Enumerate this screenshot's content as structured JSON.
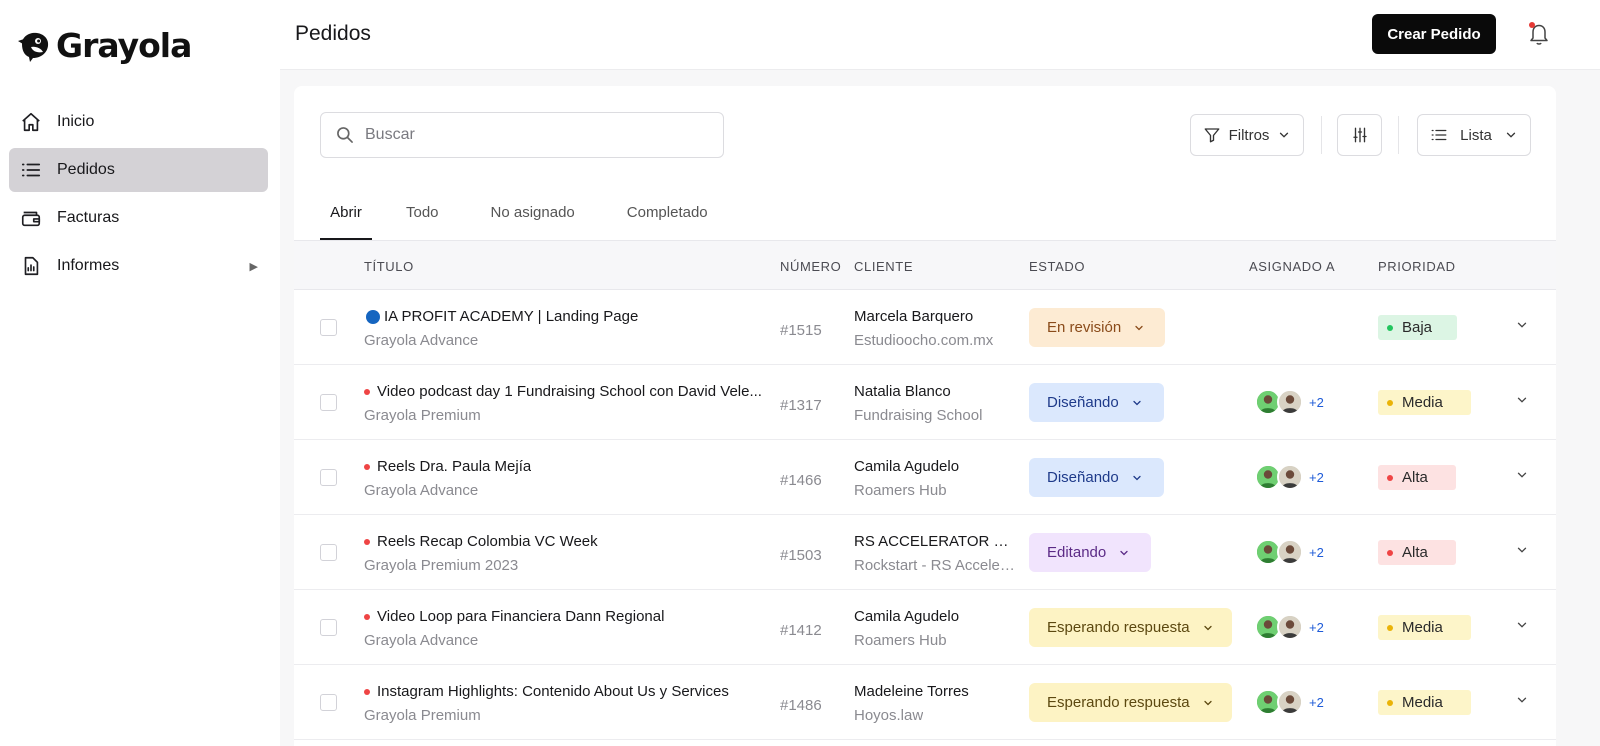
{
  "app": {
    "name": "Grayola"
  },
  "sidebar": {
    "items": [
      {
        "label": "Inicio",
        "icon": "home-icon",
        "active": false
      },
      {
        "label": "Pedidos",
        "icon": "list-icon",
        "active": true
      },
      {
        "label": "Facturas",
        "icon": "wallet-icon",
        "active": false
      },
      {
        "label": "Informes",
        "icon": "chart-icon",
        "active": false,
        "has_submenu": true
      }
    ]
  },
  "header": {
    "title": "Pedidos",
    "create_label": "Crear Pedido"
  },
  "toolbar": {
    "search_placeholder": "Buscar",
    "filters_label": "Filtros",
    "view_label": "Lista"
  },
  "tabs": [
    "Abrir",
    "Todo",
    "No asignado",
    "Completado"
  ],
  "columns": {
    "title": "TÍTULO",
    "number": "NÚMERO",
    "client": "CLIENTE",
    "status": "ESTADO",
    "assignee": "ASIGNADO A",
    "priority": "PRIORIDAD"
  },
  "colors": {
    "status": {
      "En revisión": {
        "bg": "#fdebd3",
        "fg": "#8a4b1a"
      },
      "Diseñando": {
        "bg": "#dbe8fd",
        "fg": "#1e3a8a"
      },
      "Editando": {
        "bg": "#f1e4fd",
        "fg": "#5b2a86"
      },
      "Esperando respuesta": {
        "bg": "#fdf3c4",
        "fg": "#5c4810"
      }
    },
    "priority": {
      "Baja": {
        "bg": "#dcf5e4",
        "dot": "#22c55e"
      },
      "Media": {
        "bg": "#fdf5c9",
        "dot": "#eab308"
      },
      "Alta": {
        "bg": "#fde2e2",
        "dot": "#ef4444"
      }
    }
  },
  "orders": [
    {
      "title": "IA PROFIT ACADEMY | Landing Page",
      "marker": "blue-circle",
      "plan": "Grayola Advance",
      "number": "#1515",
      "client": "Marcela Barquero",
      "company": "Estudioocho.com.mx",
      "status": "En revisión",
      "assignees": [],
      "more": "",
      "priority": "Baja"
    },
    {
      "title": "Video podcast day 1 Fundraising School con David Vele...",
      "marker": "red-dot",
      "plan": "Grayola Premium",
      "number": "#1317",
      "client": "Natalia Blanco",
      "company": "Fundraising School",
      "status": "Diseñando",
      "assignees": [
        "avatar-1",
        "avatar-2"
      ],
      "more": "+2",
      "priority": "Media"
    },
    {
      "title": "Reels Dra. Paula Mejía",
      "marker": "red-dot",
      "plan": "Grayola Advance",
      "number": "#1466",
      "client": "Camila Agudelo",
      "company": "Roamers Hub",
      "status": "Diseñando",
      "assignees": [
        "avatar-1",
        "avatar-2"
      ],
      "more": "+2",
      "priority": "Alta"
    },
    {
      "title": "Reels Recap Colombia VC Week",
      "marker": "red-dot",
      "plan": "Grayola Premium 2023",
      "number": "#1503",
      "client": "RS ACCELERATOR MA...",
      "company": "Rockstart - RS Acceler...",
      "status": "Editando",
      "assignees": [
        "avatar-1",
        "avatar-2"
      ],
      "more": "+2",
      "priority": "Alta"
    },
    {
      "title": "Video Loop para Financiera Dann Regional",
      "marker": "red-dot",
      "plan": "Grayola Advance",
      "number": "#1412",
      "client": "Camila Agudelo",
      "company": "Roamers Hub",
      "status": "Esperando respuesta",
      "assignees": [
        "avatar-1",
        "avatar-2"
      ],
      "more": "+2",
      "priority": "Media"
    },
    {
      "title": "Instagram Highlights: Contenido About Us y Services",
      "marker": "red-dot",
      "plan": "Grayola Premium",
      "number": "#1486",
      "client": "Madeleine Torres",
      "company": "Hoyos.law",
      "status": "Esperando respuesta",
      "assignees": [
        "avatar-1",
        "avatar-2"
      ],
      "more": "+2",
      "priority": "Media"
    }
  ]
}
